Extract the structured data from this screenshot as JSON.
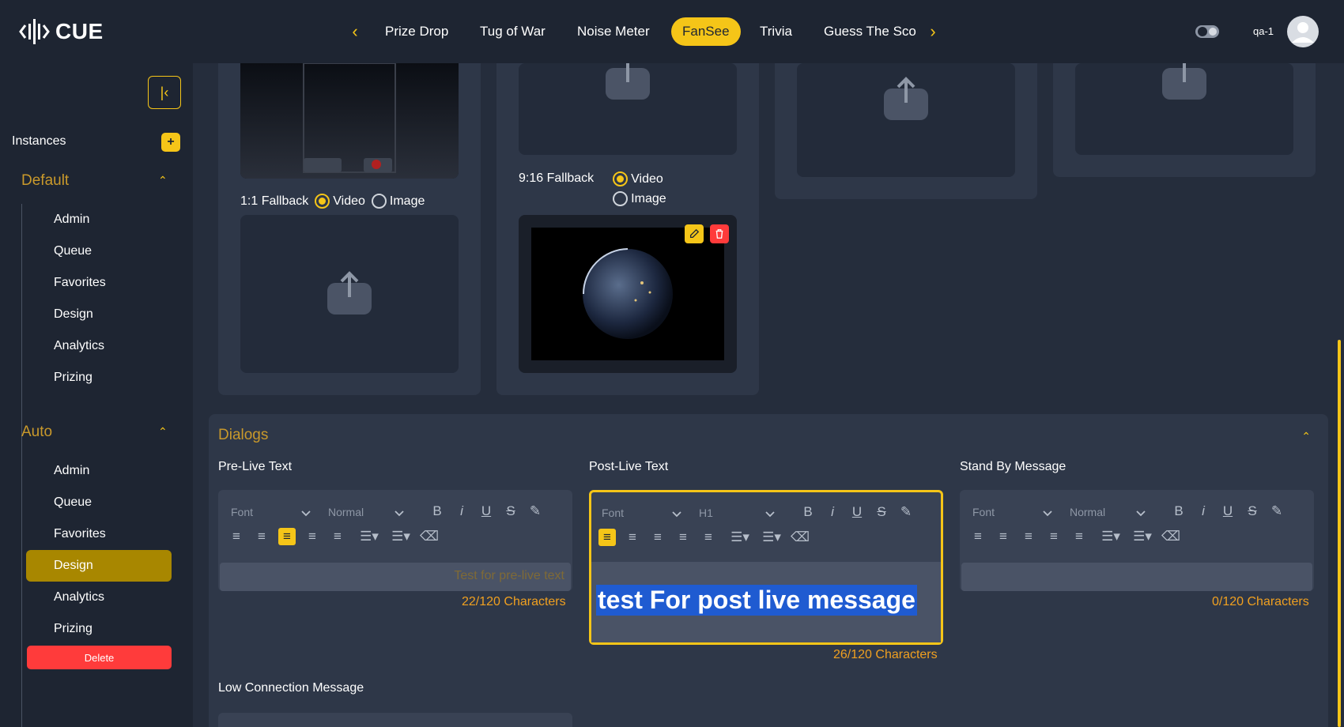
{
  "app": {
    "logo_text": "CUE",
    "user_name": "qa-1"
  },
  "nav": {
    "tabs": [
      {
        "label": "Prize Drop"
      },
      {
        "label": "Tug of War"
      },
      {
        "label": "Noise Meter"
      },
      {
        "label": "FanSee",
        "active": true
      },
      {
        "label": "Trivia"
      },
      {
        "label": "Guess The Sco"
      }
    ]
  },
  "sidebar": {
    "instances_label": "Instances",
    "add_label": "+",
    "groups": [
      {
        "title": "Default",
        "items": [
          "Admin",
          "Queue",
          "Favorites",
          "Design",
          "Analytics",
          "Prizing"
        ]
      },
      {
        "title": "Auto",
        "items": [
          "Admin",
          "Queue",
          "Favorites",
          "Design",
          "Analytics",
          "Prizing"
        ],
        "active_item": "Design"
      }
    ],
    "delete_label": "Delete"
  },
  "media": {
    "fallback_1_1": {
      "label": "1:1 Fallback",
      "video": "Video",
      "image": "Image",
      "selected": "Video"
    },
    "fallback_9_16": {
      "label": "9:16 Fallback",
      "video": "Video",
      "image": "Image",
      "selected": "Video"
    }
  },
  "dialogs": {
    "title": "Dialogs",
    "pre_live": {
      "title": "Pre-Live Text",
      "font": "Font",
      "size": "Normal",
      "placeholder": "Test for pre-live text",
      "count": "22/120 Characters"
    },
    "post_live": {
      "title": "Post-Live Text",
      "font": "Font",
      "size": "H1",
      "value": "test For post live message",
      "count": "26/120 Characters"
    },
    "stand_by": {
      "title": "Stand By Message",
      "font": "Font",
      "size": "Normal",
      "count": "0/120 Characters"
    },
    "low_connection": {
      "title": "Low Connection Message"
    }
  },
  "colors": {
    "accent": "#f5c518",
    "danger": "#ff3b3b",
    "heading": "#c9992b",
    "count": "#f0a020"
  }
}
